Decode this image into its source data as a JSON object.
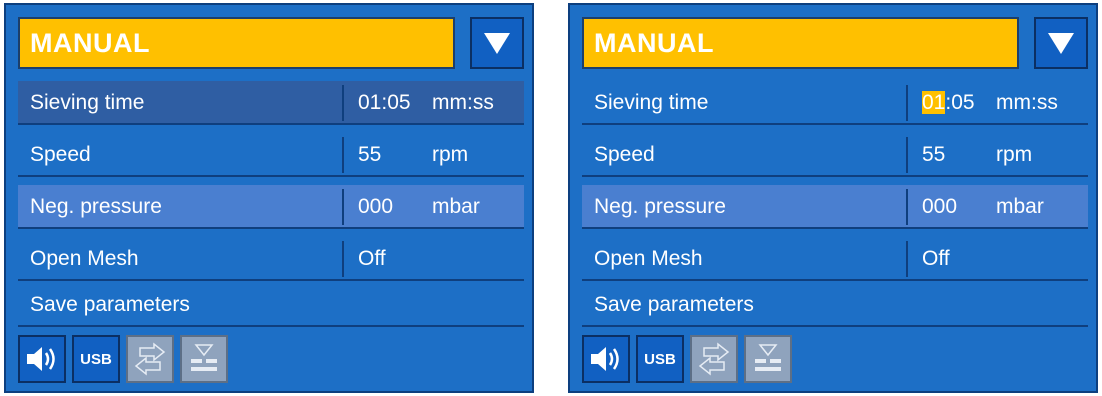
{
  "colors": {
    "panel_bg": "#1d6fc6",
    "title_bg": "#ffc000",
    "row_selected_dark": "#2f5ea3",
    "row_selected_light": "#4a7fd0",
    "edit_highlight": "#ffc000",
    "icon_disabled": "#8fa3bd"
  },
  "panels": [
    {
      "title": "MANUAL",
      "rows": [
        {
          "label": "Sieving time",
          "value": "01:05",
          "unit": "mm:ss"
        },
        {
          "label": "Speed",
          "value": "55",
          "unit": "rpm"
        },
        {
          "label": "Neg. pressure",
          "value": "000",
          "unit": "mbar"
        },
        {
          "label": "Open Mesh",
          "value": "Off",
          "unit": ""
        },
        {
          "label": "Save parameters"
        }
      ],
      "icons": [
        "speaker-icon",
        "usb-icon",
        "data-transfer-icon",
        "sieve-stack-icon"
      ],
      "usb_label": "USB"
    },
    {
      "title": "MANUAL",
      "rows": [
        {
          "label": "Sieving time",
          "value_edit": "01",
          "value_rest": ":05",
          "unit": "mm:ss"
        },
        {
          "label": "Speed",
          "value": "55",
          "unit": "rpm"
        },
        {
          "label": "Neg. pressure",
          "value": "000",
          "unit": "mbar"
        },
        {
          "label": "Open Mesh",
          "value": "Off",
          "unit": ""
        },
        {
          "label": "Save parameters"
        }
      ],
      "icons": [
        "speaker-icon",
        "usb-icon",
        "data-transfer-icon",
        "sieve-stack-icon"
      ],
      "usb_label": "USB"
    }
  ]
}
